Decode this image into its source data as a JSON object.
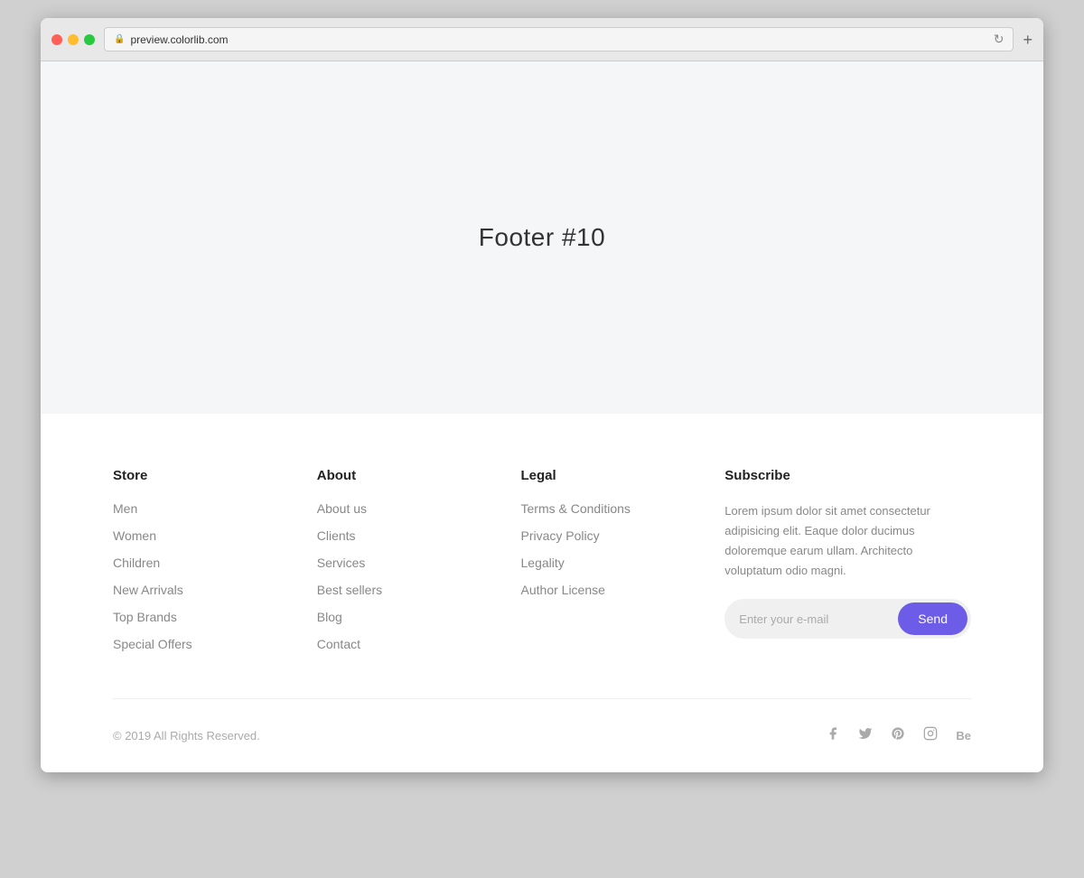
{
  "browser": {
    "url": "preview.colorlib.com",
    "new_tab_label": "+"
  },
  "hero": {
    "title": "Footer #10"
  },
  "footer": {
    "store": {
      "heading": "Store",
      "links": [
        "Men",
        "Women",
        "Children",
        "New Arrivals",
        "Top Brands",
        "Special Offers"
      ]
    },
    "about": {
      "heading": "About",
      "links": [
        "About us",
        "Clients",
        "Services",
        "Best sellers",
        "Blog",
        "Contact"
      ]
    },
    "legal": {
      "heading": "Legal",
      "links": [
        "Terms & Conditions",
        "Privacy Policy",
        "Legality",
        "Author License"
      ]
    },
    "subscribe": {
      "heading": "Subscribe",
      "description": "Lorem ipsum dolor sit amet consectetur adipisicing elit. Eaque dolor ducimus doloremque earum ullam. Architecto voluptatum odio magni.",
      "input_placeholder": "Enter your e-mail",
      "button_label": "Send"
    },
    "copyright": "© 2019 All Rights Reserved.",
    "social": [
      {
        "name": "facebook",
        "icon": "f"
      },
      {
        "name": "twitter",
        "icon": "t"
      },
      {
        "name": "pinterest",
        "icon": "p"
      },
      {
        "name": "instagram",
        "icon": "i"
      },
      {
        "name": "behance",
        "icon": "Be"
      }
    ]
  }
}
